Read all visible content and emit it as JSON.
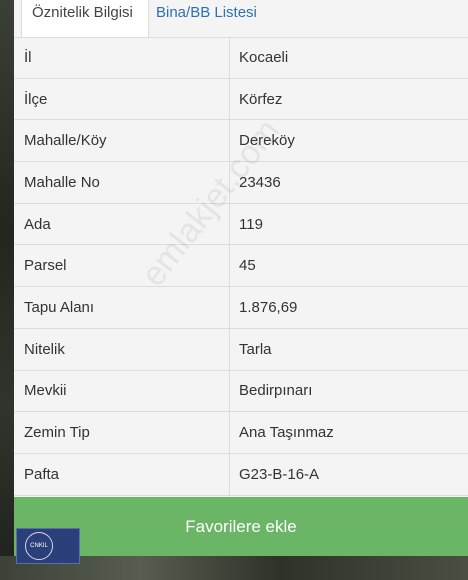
{
  "tabs": [
    {
      "label": "Öznitelik Bilgisi",
      "active": true
    },
    {
      "label": "Bina/BB Listesi",
      "active": false
    }
  ],
  "rows": [
    {
      "label": "İl",
      "value": "Kocaeli"
    },
    {
      "label": "İlçe",
      "value": "Körfez"
    },
    {
      "label": "Mahalle/Köy",
      "value": "Dereköy"
    },
    {
      "label": "Mahalle No",
      "value": "23436"
    },
    {
      "label": "Ada",
      "value": "119"
    },
    {
      "label": "Parsel",
      "value": "45"
    },
    {
      "label": "Tapu Alanı",
      "value": "1.876,69"
    },
    {
      "label": "Nitelik",
      "value": "Tarla"
    },
    {
      "label": "Mevkii",
      "value": "Bedirpınarı"
    },
    {
      "label": "Zemin Tip",
      "value": "Ana Taşınmaz"
    },
    {
      "label": "Pafta",
      "value": "G23-B-16-A"
    }
  ],
  "favorite_button": {
    "label": "Favorilere ekle"
  },
  "watermark": {
    "text": "emlakjet.com"
  },
  "logo": {
    "text": "CNKIL"
  },
  "colors": {
    "accent_tab": "#2f6fb3",
    "button": "#6ab566",
    "border": "#dcdcdc"
  }
}
